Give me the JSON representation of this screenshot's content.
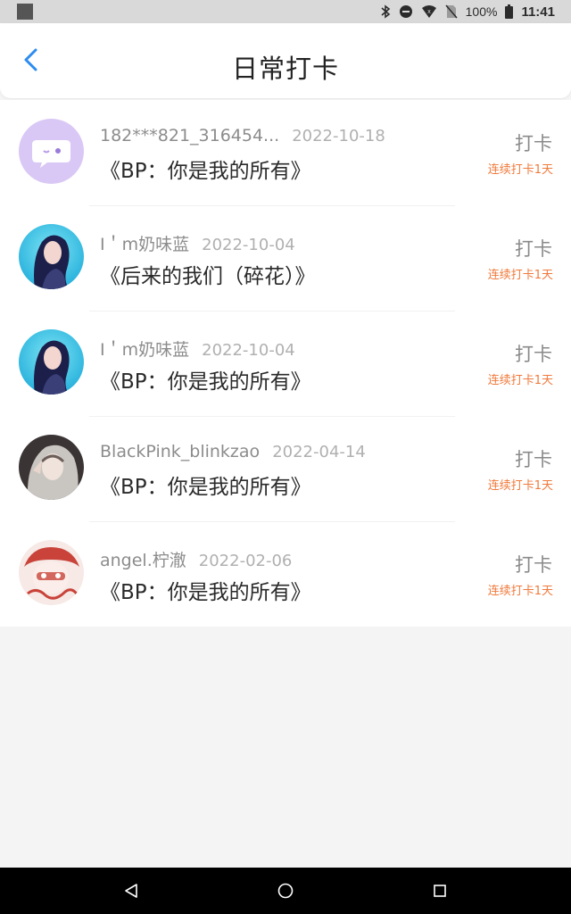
{
  "status_bar": {
    "battery": "100%",
    "time": "11:41"
  },
  "header": {
    "title": "日常打卡"
  },
  "checkins": [
    {
      "username": "182***821_316454...",
      "date": "2022-10-18",
      "book": "《BP：你是我的所有》",
      "action": "打卡",
      "streak": "连续打卡1天",
      "avatar": "default-chat-bubble"
    },
    {
      "username": "I＇m奶味蓝",
      "date": "2022-10-04",
      "book": "《后来的我们（碎花）》",
      "action": "打卡",
      "streak": "连续打卡1天",
      "avatar": "girl-blue-background"
    },
    {
      "username": "I＇m奶味蓝",
      "date": "2022-10-04",
      "book": "《BP：你是我的所有》",
      "action": "打卡",
      "streak": "连续打卡1天",
      "avatar": "girl-blue-background"
    },
    {
      "username": "BlackPink_blinkzao",
      "date": "2022-04-14",
      "book": "《BP：你是我的所有》",
      "action": "打卡",
      "streak": "连续打卡1天",
      "avatar": "girl-grey-hood"
    },
    {
      "username": "angel.柠澈",
      "date": "2022-02-06",
      "book": "《BP：你是我的所有》",
      "action": "打卡",
      "streak": "连续打卡1天",
      "avatar": "anime-girl-red"
    }
  ],
  "colors": {
    "accent": "#2d8cf0",
    "streak": "#f07a3c",
    "background": "#f5f4f5"
  }
}
